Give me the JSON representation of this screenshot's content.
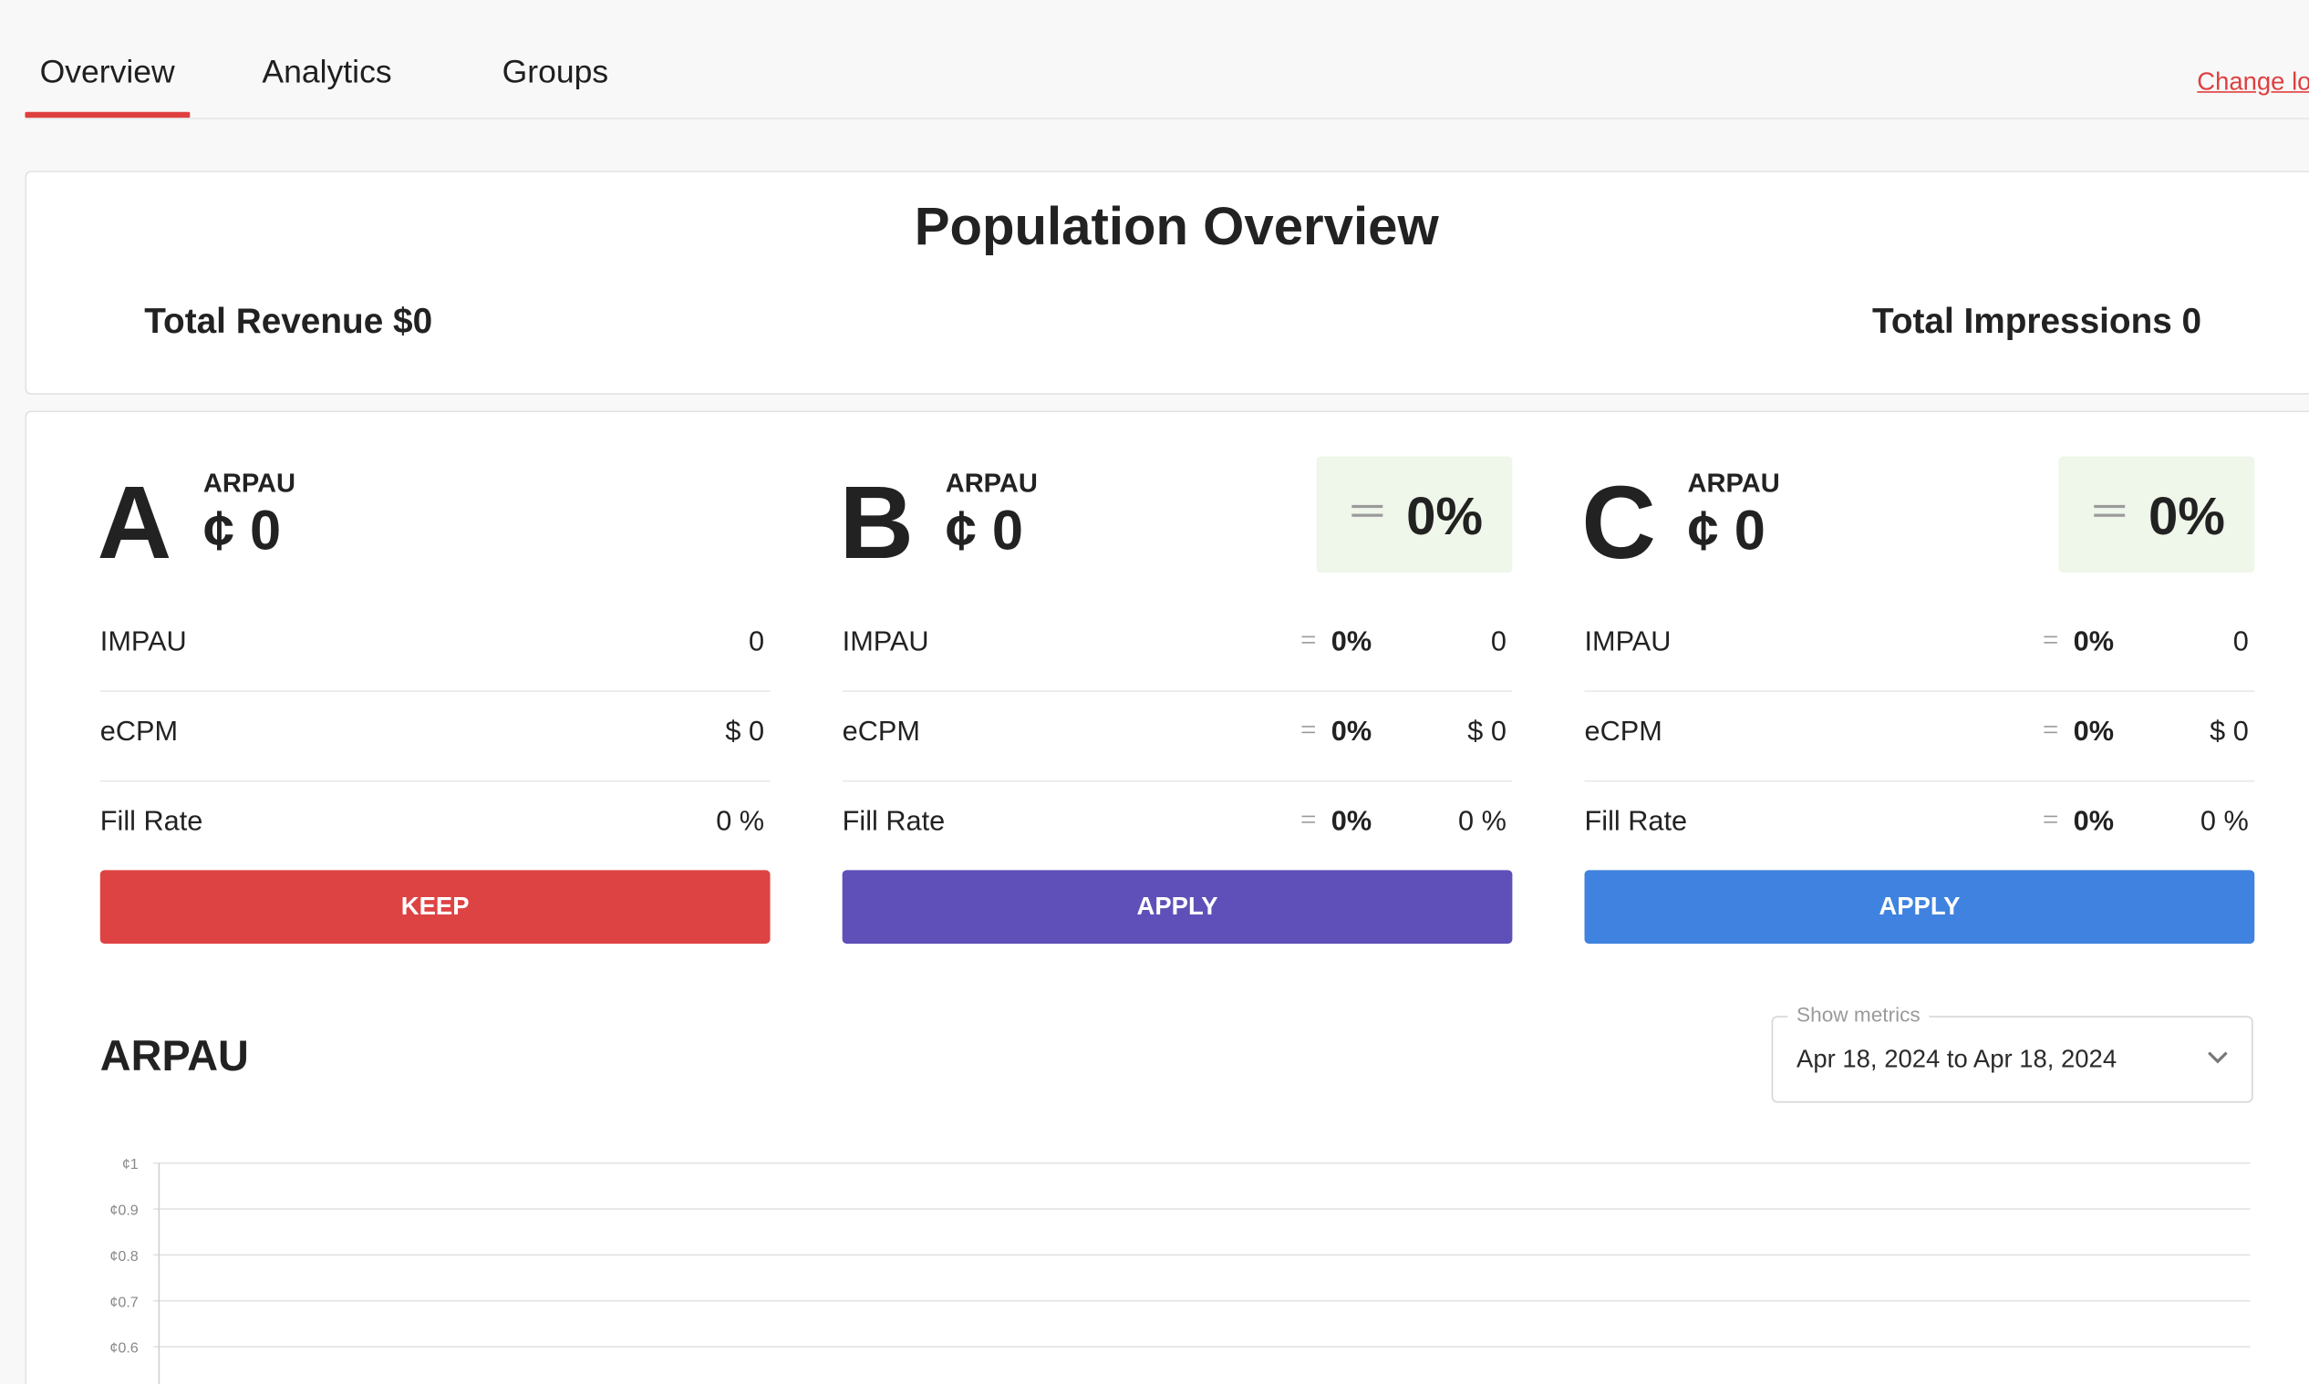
{
  "tabs": {
    "overview": "Overview",
    "analytics": "Analytics",
    "groups": "Groups",
    "change_link": "Change lo"
  },
  "overview": {
    "title": "Population Overview",
    "total_revenue": "Total Revenue $0",
    "total_impressions": "Total Impressions 0"
  },
  "variants": [
    {
      "letter": "A",
      "arpau_label": "ARPAU",
      "arpau_value": "¢ 0",
      "metrics": [
        {
          "name": "IMPAU",
          "value": "0"
        },
        {
          "name": "eCPM",
          "value": "$ 0"
        },
        {
          "name": "Fill Rate",
          "value": "0 %"
        }
      ],
      "button": "KEEP",
      "color": "#de4343"
    },
    {
      "letter": "B",
      "arpau_label": "ARPAU",
      "arpau_value": "¢ 0",
      "diff": "0%",
      "metrics": [
        {
          "name": "IMPAU",
          "diff": "0%",
          "value": "0"
        },
        {
          "name": "eCPM",
          "diff": "0%",
          "value": "$ 0"
        },
        {
          "name": "Fill Rate",
          "diff": "0%",
          "value": "0 %"
        }
      ],
      "button": "APPLY",
      "color": "#5e50b8"
    },
    {
      "letter": "C",
      "arpau_label": "ARPAU",
      "arpau_value": "¢ 0",
      "diff": "0%",
      "metrics": [
        {
          "name": "IMPAU",
          "diff": "0%",
          "value": "0"
        },
        {
          "name": "eCPM",
          "diff": "0%",
          "value": "$ 0"
        },
        {
          "name": "Fill Rate",
          "diff": "0%",
          "value": "0 %"
        }
      ],
      "button": "APPLY",
      "color": "#3f82df"
    }
  ],
  "chart": {
    "title": "ARPAU",
    "select_label": "Show metrics",
    "select_value": "Apr 18, 2024 to Apr 18, 2024"
  },
  "chart_data": {
    "type": "line",
    "title": "ARPAU",
    "y_ticks": [
      "¢1",
      "¢0.9",
      "¢0.8",
      "¢0.7",
      "¢0.6"
    ],
    "ylim": [
      0.6,
      1
    ],
    "grid": true,
    "series": []
  }
}
